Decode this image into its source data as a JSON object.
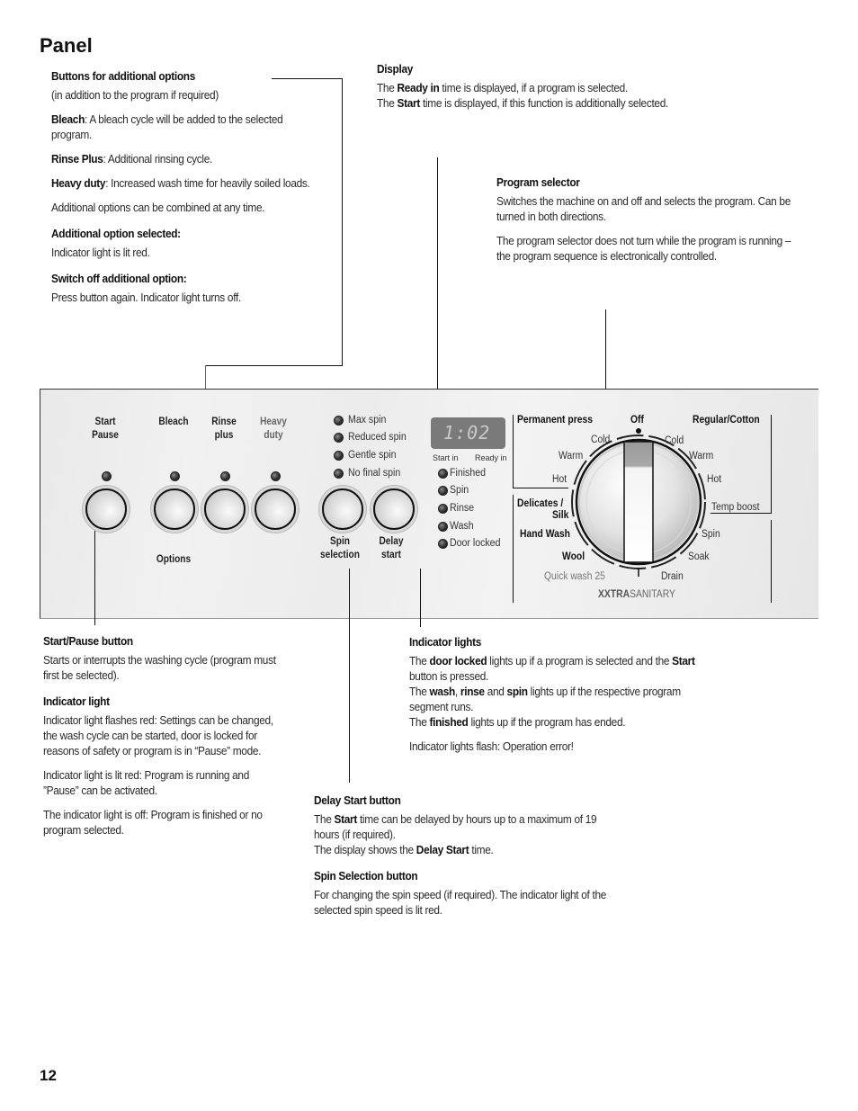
{
  "page": {
    "title": "Panel",
    "page_number": "12"
  },
  "options_section": {
    "heading": "Buttons for additional options",
    "subheading": "(in addition to the program if required)",
    "items": [
      {
        "term": "Bleach",
        "text": ": A bleach cycle will be added to the selected program."
      },
      {
        "term": "Rinse Plus",
        "text": ": Additional rinsing cycle."
      },
      {
        "term": "Heavy duty",
        "text": ": Increased wash time for heavily soiled loads."
      }
    ],
    "combine_note": "Additional options can be combined at any time.",
    "selected_heading": "Additional option selected:",
    "selected_text": "Indicator light is lit red.",
    "switch_off_heading": "Switch off additional option:",
    "switch_off_text": "Press button again. Indicator light turns off."
  },
  "display_section": {
    "heading": "Display",
    "line1_pre": "The ",
    "line1_bold": "Ready in",
    "line1_post": " time is displayed, if a program is selected.",
    "line2_pre": "The ",
    "line2_bold": "Start",
    "line2_post": "  time is displayed, if this function is additionally selected."
  },
  "program_selector_section": {
    "heading": "Program selector",
    "para1": "Switches the machine on and off and selects the program. Can be turned in both directions.",
    "para2": "The program selector does not turn while the program is running – the program sequence is electronically controlled."
  },
  "panel": {
    "buttons": [
      {
        "label1": "Start",
        "label2": "Pause"
      },
      {
        "label1": "Bleach",
        "label2": ""
      },
      {
        "label1": "Rinse",
        "label2": "plus"
      },
      {
        "label1": "Heavy",
        "label2": "duty"
      }
    ],
    "options_label": "Options",
    "spin_options": [
      "Max spin",
      "Reduced spin",
      "Gentle spin",
      "No final spin"
    ],
    "spin_button": {
      "label1": "Spin",
      "label2": "selection"
    },
    "delay_button": {
      "label1": "Delay",
      "label2": "start"
    },
    "display_value": "1:02",
    "display_start_in": "Start in",
    "display_ready_in": "Ready in",
    "status_lights": [
      "Finished",
      "Spin",
      "Rinse",
      "Wash",
      "Door locked"
    ],
    "dial": {
      "off": "Off",
      "permanent_press": "Permanent press",
      "regular_cotton": "Regular/Cotton",
      "pp_cold": "Cold",
      "pp_warm": "Warm",
      "pp_hot": "Hot",
      "rc_cold": "Cold",
      "rc_warm": "Warm",
      "rc_hot": "Hot",
      "temp_boost": "Temp boost",
      "delicates": "Delicates /",
      "silk": "Silk",
      "hand_wash": "Hand Wash",
      "wool": "Wool",
      "quick_wash": "Quick wash 25",
      "drain": "Drain",
      "soak": "Soak",
      "spin": "Spin",
      "xxtra": "XXTRA",
      "sanitary": "SANITARY"
    }
  },
  "start_pause_section": {
    "heading": "Start/Pause button",
    "text": "Starts or interrupts the washing cycle (program must first be selected).",
    "indicator_heading": "Indicator light",
    "para1": "Indicator light flashes red: Settings can be changed, the wash cycle can be started, door is locked for reasons of safety or program is in “Pause” mode.",
    "para2": "Indicator light is lit red: Program is running and ”Pause” can be activated.",
    "para3": "The indicator light is off: Program is finished or no program selected."
  },
  "indicator_lights_section": {
    "heading": "Indicator lights",
    "s1_pre": "The ",
    "s1_b": "door locked",
    "s1_post": " lights up if a program is selected and the ",
    "s1_b2": "Start",
    "s1_post2": " button is pressed.",
    "s2_pre": "The ",
    "s2_b1": "wash",
    "s2_sep1": ", ",
    "s2_b2": "rinse",
    "s2_sep2": " and ",
    "s2_b3": "spin",
    "s2_post": " lights up if the respective program segment runs.",
    "s3_pre": "The ",
    "s3_b": "finished",
    "s3_post": " lights up if the program has ended.",
    "error": "Indicator lights flash: Operation error!"
  },
  "delay_section": {
    "heading": "Delay Start button",
    "pre": "The ",
    "b1": "Start",
    "mid": " time can be delayed by hours up to a maximum of 19 hours (if required).",
    "line2_pre": "The display shows the ",
    "b2": "Delay Start",
    "line2_post": " time."
  },
  "spin_section": {
    "heading": "Spin Selection button",
    "text": "For changing the spin speed (if required). The indicator light of the selected spin speed is lit red."
  }
}
